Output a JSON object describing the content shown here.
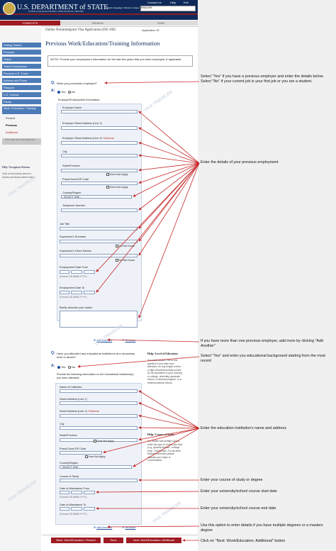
{
  "header": {
    "title": "U.S. DEPARTMENT of STATE",
    "subtitle": "CONSULAR ELECTRONIC APPLICATION CENTER",
    "top_links": [
      "Contact Us",
      "Help",
      "Exit"
    ],
    "language_label": "Select Language / Idioma / Langue",
    "language_value": "ENGLISH"
  },
  "progress": {
    "complete": "COMPLETE",
    "review": "REVIEW",
    "sign": "SIGN"
  },
  "sidebar": {
    "items": [
      {
        "label": "Getting Started"
      },
      {
        "label": "Personal"
      },
      {
        "label": "Travel"
      },
      {
        "label": "Travel Companions"
      },
      {
        "label": "Previous U.S. Travel"
      },
      {
        "label": "Address and Phone"
      },
      {
        "label": "Passport"
      },
      {
        "label": "U.S. Contact"
      },
      {
        "label": "Family"
      },
      {
        "label": "Work / Education / Training"
      }
    ],
    "sub_items": [
      "Present",
      "Previous",
      "Additional",
      "Security and Background"
    ],
    "help_title": "Help: Navigation Buttons",
    "help_body": "Click on the buttons above to access previously entered data."
  },
  "main": {
    "app_title": "Online Nonimmigrant Visa Application (DS-160)",
    "app_id_label": "Application ID",
    "section_title": "Previous Work/Education/Training Information",
    "note": "NOTE: Provide your employment information for the last five years that you were employed, if applicable.",
    "q1": "Were you previously employed?",
    "yes": "Yes",
    "no": "No",
    "employer_info": "Employer/Employment Information:",
    "employer_fields": {
      "name": "Employer Name",
      "street1": "Employer Street Address (Line 1)",
      "street2": "Employer Street Address (Line 2)",
      "optional": "*Optional",
      "city": "City",
      "state": "State/Province",
      "zip": "Postal Zone/ZIP Code",
      "country": "Country/Region",
      "select_one": "- SELECT ONE -",
      "phone": "Telephone Number",
      "job": "Job Title",
      "sup_surname": "Supervisor's Surname",
      "sup_given": "Supervisor's Given Names",
      "date_from": "Employment Date From",
      "date_to": "Employment Date To",
      "format": "(Format: DD-MMM-YYYY)",
      "duties": "Briefly describe your duties:",
      "does_not_apply": "Does Not Apply",
      "do_not_know": "Do Not Know"
    },
    "add_another": "Add Another",
    "remove": "Remove",
    "q2": "Have you attended any educational institutions at a secondary level or above?",
    "q2_help_title": "Help: Level of Education",
    "q2_help_body": "You must answer Yes to this question if you have ever attended, for any length of time, a high school/secondary school (or its equivalent in your country) or college, university, graduate school, a doctoral program, or a trade/vocational school.",
    "edu_info": "Provide the following information on the educational institution(s) you have attended.",
    "edu_fields": {
      "name": "Name of Institution",
      "street1": "Street Address (Line 1)",
      "street2": "Street Address (Line 2)",
      "optional": "*Optional",
      "city": "City",
      "state": "State/Province",
      "zip": "Postal Zone/ZIP Code",
      "country": "Country/Region",
      "select_one": "- SELECT ONE -",
      "course": "Course of Study",
      "date_from": "Date of Attendance From",
      "date_to": "Date of Attendance To",
      "format": "(Format: DD-MMM-YYYY)",
      "does_not_apply": "Does Not Apply"
    },
    "edu_help_title": "Help: Course of Study",
    "edu_help_body": "For middle school/high school, enter the type of course you took (e.g. 'general studies', 'college prep', 'vocational'). For all other educational levels please indicate your major or concentration."
  },
  "bottom": {
    "back": "Back: Work/Education: Present",
    "save": "Save",
    "next": "Next: Work/Education: Additional"
  },
  "watermark": "VISA TRAVELER",
  "annotations": [
    "Select \"Yes\" if you have a previous employer and enter the details below. Select \"No\" if your current job is your first job or you are a student.",
    "Enter the details of your previous employment",
    "If you have more than one previous employer, add more by clicking \"Add Another\"",
    "Select \"Yes\" and enter you educational background starting from the most recent",
    "Enter the education institution's name and address",
    "Enter your course of study or degree",
    "Enter your university/school course start date",
    "Enter your university/school course end date",
    "Use this option to enter details if you have multiple degrees or a masters degree",
    "Click on \"Next: Work/Education: Additional\" button"
  ],
  "colors": {
    "navy": "#0f2a5a",
    "red": "#9e1b23",
    "nav_blue": "#4d7bb8",
    "link_blue": "#1a4f9a",
    "arrow": "#c62828"
  }
}
